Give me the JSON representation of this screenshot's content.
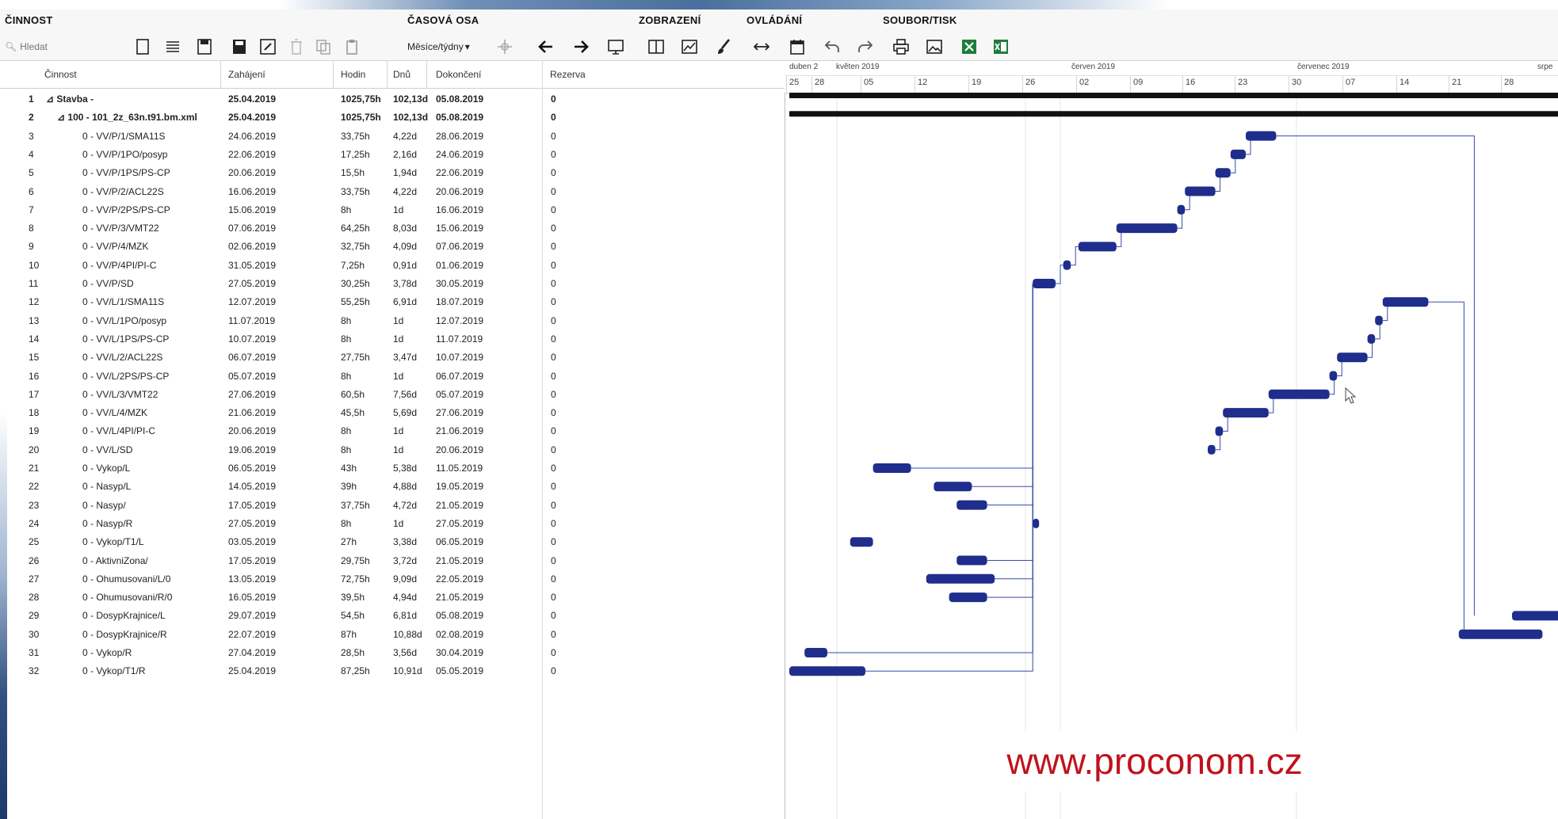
{
  "toolbar": {
    "groups": [
      "ČINNOST",
      "ČASOVÁ OSA",
      "ZOBRAZENÍ",
      "OVLÁDÁNÍ",
      "SOUBOR/TISK"
    ],
    "search_placeholder": "Hledat",
    "timescale": "Měsíce/týdny",
    "icons": [
      "new-icon",
      "list-icon",
      "save-icon",
      "save-as-icon",
      "edit-icon",
      "delete-icon",
      "copy-icon",
      "paste-icon",
      "zoom-fit-icon",
      "arrow-left-icon",
      "arrow-right-icon",
      "presentation-icon",
      "split-view-icon",
      "chart-line-icon",
      "brush-icon",
      "expand-horizontal-icon",
      "calendar-icon",
      "undo-icon",
      "redo-icon",
      "print-icon",
      "image-export-icon",
      "excel-export-icon",
      "excel-import-icon",
      "excel-icon"
    ]
  },
  "columns": [
    "Činnost",
    "Zahájení",
    "Hodin",
    "Dnů",
    "Dokončení",
    "Rezerva"
  ],
  "rows": [
    {
      "n": "1",
      "name": "⊿ Stavba -",
      "start": "25.04.2019",
      "hours": "1025,75h",
      "days": "102,13d",
      "end": "05.08.2019",
      "res": "0",
      "bold": true,
      "indent": 0
    },
    {
      "n": "2",
      "name": "⊿ 100 - 101_2z_63n.t91.bm.xml",
      "start": "25.04.2019",
      "hours": "1025,75h",
      "days": "102,13d",
      "end": "05.08.2019",
      "res": "0",
      "bold": true,
      "indent": 1
    },
    {
      "n": "3",
      "name": "0 - VV/P/1/SMA11S",
      "start": "24.06.2019",
      "hours": "33,75h",
      "days": "4,22d",
      "end": "28.06.2019",
      "res": "0",
      "indent": 2
    },
    {
      "n": "4",
      "name": "0 - VV/P/1PO/posyp",
      "start": "22.06.2019",
      "hours": "17,25h",
      "days": "2,16d",
      "end": "24.06.2019",
      "res": "0",
      "indent": 2
    },
    {
      "n": "5",
      "name": "0 - VV/P/1PS/PS-CP",
      "start": "20.06.2019",
      "hours": "15,5h",
      "days": "1,94d",
      "end": "22.06.2019",
      "res": "0",
      "indent": 2
    },
    {
      "n": "6",
      "name": "0 - VV/P/2/ACL22S",
      "start": "16.06.2019",
      "hours": "33,75h",
      "days": "4,22d",
      "end": "20.06.2019",
      "res": "0",
      "indent": 2
    },
    {
      "n": "7",
      "name": "0 - VV/P/2PS/PS-CP",
      "start": "15.06.2019",
      "hours": "8h",
      "days": "1d",
      "end": "16.06.2019",
      "res": "0",
      "indent": 2
    },
    {
      "n": "8",
      "name": "0 - VV/P/3/VMT22",
      "start": "07.06.2019",
      "hours": "64,25h",
      "days": "8,03d",
      "end": "15.06.2019",
      "res": "0",
      "indent": 2
    },
    {
      "n": "9",
      "name": "0 - VV/P/4/MZK",
      "start": "02.06.2019",
      "hours": "32,75h",
      "days": "4,09d",
      "end": "07.06.2019",
      "res": "0",
      "indent": 2
    },
    {
      "n": "10",
      "name": "0 - VV/P/4PI/PI-C",
      "start": "31.05.2019",
      "hours": "7,25h",
      "days": "0,91d",
      "end": "01.06.2019",
      "res": "0",
      "indent": 2
    },
    {
      "n": "11",
      "name": "0 - VV/P/SD",
      "start": "27.05.2019",
      "hours": "30,25h",
      "days": "3,78d",
      "end": "30.05.2019",
      "res": "0",
      "indent": 2
    },
    {
      "n": "12",
      "name": "0 - VV/L/1/SMA11S",
      "start": "12.07.2019",
      "hours": "55,25h",
      "days": "6,91d",
      "end": "18.07.2019",
      "res": "0",
      "indent": 2
    },
    {
      "n": "13",
      "name": "0 - VV/L/1PO/posyp",
      "start": "11.07.2019",
      "hours": "8h",
      "days": "1d",
      "end": "12.07.2019",
      "res": "0",
      "indent": 2
    },
    {
      "n": "14",
      "name": "0 - VV/L/1PS/PS-CP",
      "start": "10.07.2019",
      "hours": "8h",
      "days": "1d",
      "end": "11.07.2019",
      "res": "0",
      "indent": 2
    },
    {
      "n": "15",
      "name": "0 - VV/L/2/ACL22S",
      "start": "06.07.2019",
      "hours": "27,75h",
      "days": "3,47d",
      "end": "10.07.2019",
      "res": "0",
      "indent": 2
    },
    {
      "n": "16",
      "name": "0 - VV/L/2PS/PS-CP",
      "start": "05.07.2019",
      "hours": "8h",
      "days": "1d",
      "end": "06.07.2019",
      "res": "0",
      "indent": 2
    },
    {
      "n": "17",
      "name": "0 - VV/L/3/VMT22",
      "start": "27.06.2019",
      "hours": "60,5h",
      "days": "7,56d",
      "end": "05.07.2019",
      "res": "0",
      "indent": 2
    },
    {
      "n": "18",
      "name": "0 - VV/L/4/MZK",
      "start": "21.06.2019",
      "hours": "45,5h",
      "days": "5,69d",
      "end": "27.06.2019",
      "res": "0",
      "indent": 2
    },
    {
      "n": "19",
      "name": "0 - VV/L/4PI/PI-C",
      "start": "20.06.2019",
      "hours": "8h",
      "days": "1d",
      "end": "21.06.2019",
      "res": "0",
      "indent": 2
    },
    {
      "n": "20",
      "name": "0 - VV/L/SD",
      "start": "19.06.2019",
      "hours": "8h",
      "days": "1d",
      "end": "20.06.2019",
      "res": "0",
      "indent": 2
    },
    {
      "n": "21",
      "name": "0 - Vykop/L",
      "start": "06.05.2019",
      "hours": "43h",
      "days": "5,38d",
      "end": "11.05.2019",
      "res": "0",
      "indent": 2
    },
    {
      "n": "22",
      "name": "0 - Nasyp/L",
      "start": "14.05.2019",
      "hours": "39h",
      "days": "4,88d",
      "end": "19.05.2019",
      "res": "0",
      "indent": 2
    },
    {
      "n": "23",
      "name": "0 - Nasyp/",
      "start": "17.05.2019",
      "hours": "37,75h",
      "days": "4,72d",
      "end": "21.05.2019",
      "res": "0",
      "indent": 2
    },
    {
      "n": "24",
      "name": "0 - Nasyp/R",
      "start": "27.05.2019",
      "hours": "8h",
      "days": "1d",
      "end": "27.05.2019",
      "res": "0",
      "indent": 2
    },
    {
      "n": "25",
      "name": "0 - Vykop/T1/L",
      "start": "03.05.2019",
      "hours": "27h",
      "days": "3,38d",
      "end": "06.05.2019",
      "res": "0",
      "indent": 2
    },
    {
      "n": "26",
      "name": "0 - AktivniZona/",
      "start": "17.05.2019",
      "hours": "29,75h",
      "days": "3,72d",
      "end": "21.05.2019",
      "res": "0",
      "indent": 2
    },
    {
      "n": "27",
      "name": "0 - Ohumusovani/L/0",
      "start": "13.05.2019",
      "hours": "72,75h",
      "days": "9,09d",
      "end": "22.05.2019",
      "res": "0",
      "indent": 2
    },
    {
      "n": "28",
      "name": "0 - Ohumusovani/R/0",
      "start": "16.05.2019",
      "hours": "39,5h",
      "days": "4,94d",
      "end": "21.05.2019",
      "res": "0",
      "indent": 2
    },
    {
      "n": "29",
      "name": "0 - DosypKrajnice/L",
      "start": "29.07.2019",
      "hours": "54,5h",
      "days": "6,81d",
      "end": "05.08.2019",
      "res": "0",
      "indent": 2
    },
    {
      "n": "30",
      "name": "0 - DosypKrajnice/R",
      "start": "22.07.2019",
      "hours": "87h",
      "days": "10,88d",
      "end": "02.08.2019",
      "res": "0",
      "indent": 2
    },
    {
      "n": "31",
      "name": "0 - Vykop/R",
      "start": "27.04.2019",
      "hours": "28,5h",
      "days": "3,56d",
      "end": "30.04.2019",
      "res": "0",
      "indent": 2
    },
    {
      "n": "32",
      "name": "0 - Vykop/T1/R",
      "start": "25.04.2019",
      "hours": "87,25h",
      "days": "10,91d",
      "end": "05.05.2019",
      "res": "0",
      "indent": 2
    }
  ],
  "timeline": {
    "months": [
      "duben 2",
      "květen 2019",
      "červen 2019",
      "červenec 2019",
      "srpe"
    ],
    "weeks": [
      "25",
      "28",
      "05",
      "12",
      "19",
      "26",
      "02",
      "09",
      "16",
      "23",
      "30",
      "07",
      "14",
      "21",
      "28"
    ],
    "bar_color": "#1f2d8c"
  },
  "watermark": "www.proconom.cz"
}
